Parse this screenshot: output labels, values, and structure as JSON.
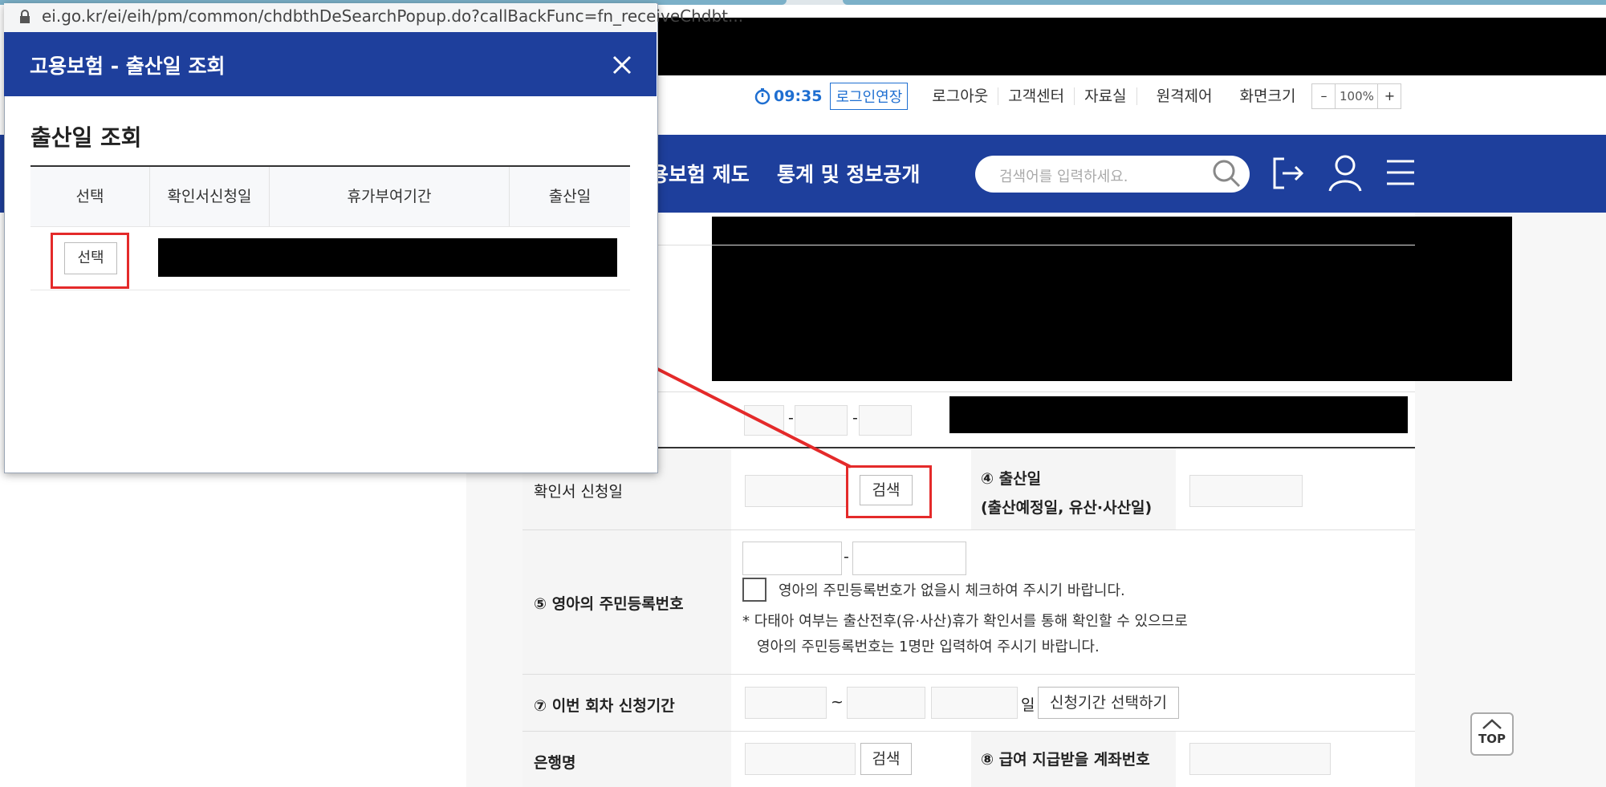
{
  "browser": {
    "url": "ei.go.kr/ei/eih/pm/common/chdbthDeSearchPopup.do?callBackFunc=fn_receiveChdbt..."
  },
  "popup": {
    "title": "고용보험 - 출산일 조회",
    "close_icon": "close-icon",
    "section_title": "출산일 조회",
    "table": {
      "headers": [
        "선택",
        "확인서신청일",
        "휴가부여기간",
        "출산일"
      ],
      "rows": [
        {
          "select_label": "선택"
        }
      ]
    }
  },
  "header": {
    "timer": "09:35",
    "login_extend": "로그인연장",
    "utility_links": [
      "로그아웃",
      "고객센터",
      "자료실",
      "원격제어"
    ],
    "zoom_label": "화면크기",
    "zoom_minus": "–",
    "zoom_value": "100%",
    "zoom_plus": "+"
  },
  "nav": {
    "items": [
      "용보험 제도",
      "통계 및 정보공개"
    ],
    "search_placeholder": "검색어를 입력하세요."
  },
  "form": {
    "confirm_date_label": "확인서 신청일",
    "search_button": "검색",
    "birth_date_label": "④ 출산일",
    "birth_date_sub": "(출산예정일, 유산·사산일)",
    "infant_id_label": "⑤ 영아의 주민등록번호",
    "infant_id_sep": "-",
    "phone_sep": "-",
    "no_id_checkbox_label": "영아의 주민등록번호가 없을시 체크하여 주시기 바랍니다.",
    "note_line1": "* 다태아 여부는 출산전후(유·사산)휴가 확인서를 통해 확인할 수 있으므로",
    "note_line2": "영아의 주민등록번호는 1명만 입력하여 주시기 바랍니다.",
    "period_label": "⑦ 이번 회차 신청기간",
    "period_tilde": "~",
    "period_day": "일",
    "period_button": "신청기간 선택하기",
    "bank_label": "은행명",
    "bank_search_button": "검색",
    "account_label": "⑧ 급여 지급받을 계좌번호"
  },
  "top_button": "TOP",
  "colors": {
    "nav_blue": "#1e3f9c",
    "annotation_red": "#e42a2a"
  }
}
